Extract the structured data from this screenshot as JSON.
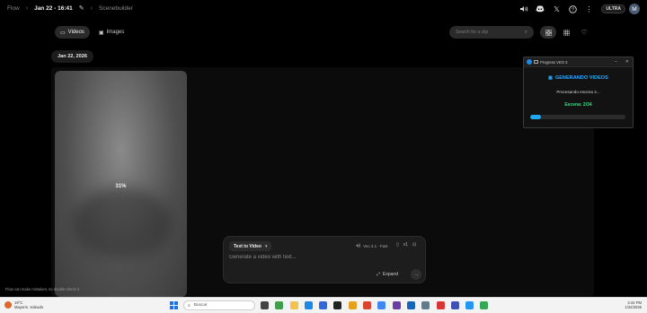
{
  "breadcrumb": {
    "root": "Flow",
    "project": "Jan 22 - 16:41",
    "page": "Scenebuilder"
  },
  "top_icons": [
    "speaker-icon",
    "discord-icon",
    "x-icon",
    "help-icon",
    "more-icon"
  ],
  "plan_badge": "ULTRA",
  "avatar_initial": "M",
  "toolbar": {
    "tabs": [
      {
        "label": "Videos",
        "icon": "video-icon",
        "active": true
      },
      {
        "label": "Images",
        "icon": "image-icon",
        "active": false
      }
    ],
    "search_placeholder": "Search for a clip",
    "views": [
      "grid-large",
      "grid-small",
      "favorites"
    ]
  },
  "date_group": "Jan 22, 2026",
  "clip": {
    "progress_label": "31%",
    "progress": 0.31
  },
  "prompt_panel": {
    "mode": "Text to Video",
    "model": "Veo 3.1 - Fast",
    "count": "x1",
    "placeholder": "Generate a video with text...",
    "expand_label": "Expand"
  },
  "disclaimer": "Flow can make mistakes, so double-check it",
  "progress_window": {
    "title": "Progreso VEO 3",
    "heading": "GENERANDO VIDEOS",
    "status": "Procesando escena 2...",
    "scene": "Escena: 2/34",
    "progress": 0.11,
    "colors": {
      "heading": "#29a8ff",
      "scene": "#3ddc84",
      "bar": "#21a8f3"
    }
  },
  "taskbar": {
    "weather_temp": "19°C",
    "weather_desc": "Mayorm. soleado",
    "search_label": "Buscar",
    "time": "4:44 PM",
    "date": "1/22/2026"
  }
}
